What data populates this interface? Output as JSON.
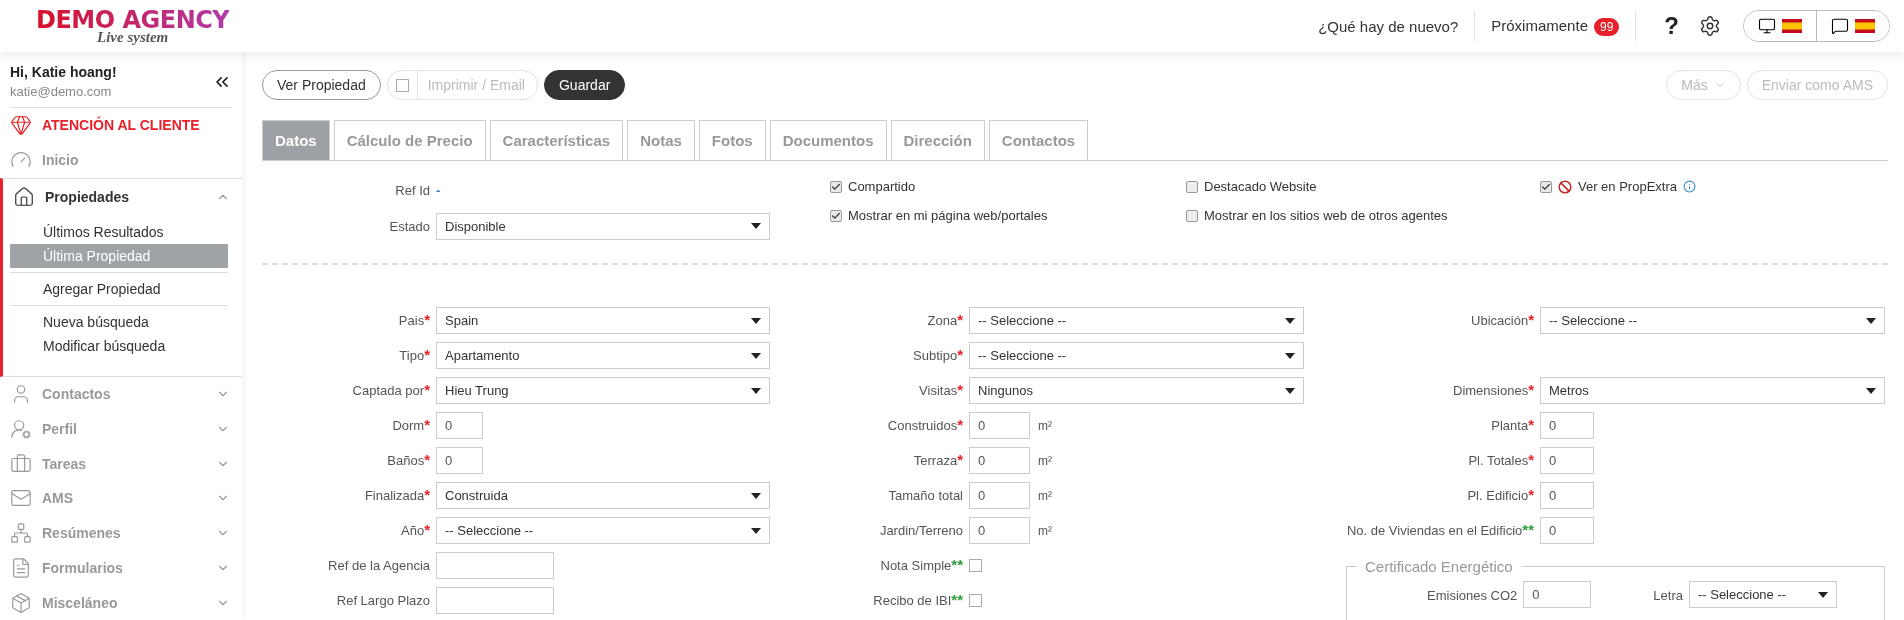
{
  "brand": {
    "name": "DEMO AGENCY",
    "tagline": "Live system"
  },
  "header": {
    "whats_new": "¿Qué hay de nuevo?",
    "upcoming": {
      "label": "Próximamente",
      "badge": "99"
    },
    "help": "?"
  },
  "user": {
    "greeting": "Hi, Katie hoang!",
    "email": "katie@demo.com"
  },
  "sidebar": {
    "items": [
      {
        "label": "ATENCIÓN AL CLIENTE",
        "kind": "highlight"
      },
      {
        "label": "Inicio",
        "kind": "link"
      },
      {
        "label": "Propiedades",
        "kind": "menu",
        "expanded": true,
        "child_groups": [
          {
            "items": [
              {
                "label": "Últimos Resultados",
                "selected": false
              },
              {
                "label": "Última Propiedad",
                "selected": true
              }
            ]
          },
          {
            "items": [
              {
                "label": "Agregar Propiedad",
                "selected": false
              }
            ]
          },
          {
            "items": [
              {
                "label": "Nueva búsqueda",
                "selected": false
              },
              {
                "label": "Modificar búsqueda",
                "selected": false
              }
            ]
          }
        ]
      },
      {
        "label": "Contactos",
        "kind": "menu",
        "expanded": false
      },
      {
        "label": "Perfil",
        "kind": "menu",
        "expanded": false
      },
      {
        "label": "Tareas",
        "kind": "menu",
        "expanded": false
      },
      {
        "label": "AMS",
        "kind": "menu",
        "expanded": false
      },
      {
        "label": "Resúmenes",
        "kind": "menu",
        "expanded": false
      },
      {
        "label": "Formularios",
        "kind": "menu",
        "expanded": false
      },
      {
        "label": "Misceláneo",
        "kind": "menu",
        "expanded": false
      }
    ]
  },
  "toolbar": {
    "buttons": [
      {
        "label": "Ver Propiedad",
        "kind": "outline",
        "disabled": false
      },
      {
        "label": "Imprimir / Email",
        "kind": "check",
        "disabled": true,
        "checked": false
      },
      {
        "label": "Guardar",
        "kind": "primary",
        "disabled": false
      }
    ],
    "right_buttons": [
      {
        "label": "Más",
        "kind": "dropdown",
        "disabled": true
      },
      {
        "label": "Enviar como AMS",
        "kind": "outline",
        "disabled": true
      }
    ]
  },
  "tabs": [
    {
      "label": "Datos",
      "selected": true
    },
    {
      "label": "Cálculo de Precio",
      "selected": false
    },
    {
      "label": "Características",
      "selected": false
    },
    {
      "label": "Notas",
      "selected": false
    },
    {
      "label": "Fotos",
      "selected": false
    },
    {
      "label": "Documentos",
      "selected": false
    },
    {
      "label": "Dirección",
      "selected": false
    },
    {
      "label": "Contactos",
      "selected": false
    }
  ],
  "summary": {
    "ref_id": {
      "label": "Ref Id",
      "value": "-"
    },
    "estado": {
      "label": "Estado",
      "value": "Disponible"
    },
    "options": [
      {
        "label": "Compartido",
        "checked": true
      },
      {
        "label": "Destacado Website",
        "checked": false
      },
      {
        "label": "Ver en PropExtra",
        "checked": true,
        "blocked": true,
        "info": true
      },
      {
        "label": "Mostrar en mi página web/portales",
        "checked": true
      },
      {
        "label": "Mostrar en los sitios web de otros agentes",
        "checked": false
      }
    ]
  },
  "form": {
    "columns": [
      {
        "fields": [
          {
            "kind": "select",
            "label": "Pais",
            "marker": {
              "text": "*",
              "color": "#e8202a"
            },
            "value": "Spain"
          },
          {
            "kind": "select",
            "label": "Tipo",
            "marker": {
              "text": "*",
              "color": "#e8202a"
            },
            "value": "Apartamento"
          },
          {
            "kind": "select",
            "label": "Captada por",
            "marker": {
              "text": "*",
              "color": "#e8202a"
            },
            "value": "Hieu Trung"
          },
          {
            "kind": "input",
            "label": "Dorm",
            "marker": {
              "text": "*",
              "color": "#e8202a"
            },
            "value": "0"
          },
          {
            "kind": "input",
            "label": "Baños",
            "marker": {
              "text": "*",
              "color": "#e8202a"
            },
            "value": "0"
          },
          {
            "kind": "select",
            "label": "Finalizada",
            "marker": {
              "text": "*",
              "color": "#e8202a"
            },
            "value": "Construida"
          },
          {
            "kind": "select",
            "label": "Año",
            "marker": {
              "text": "*",
              "color": "#e8202a"
            },
            "value": "-- Seleccione --"
          },
          {
            "kind": "text",
            "label": "Ref de la Agencia"
          },
          {
            "kind": "text",
            "label": "Ref Largo Plazo"
          }
        ]
      },
      {
        "fields": [
          {
            "kind": "select",
            "label": "Zona",
            "marker": {
              "text": "*",
              "color": "#e8202a"
            },
            "value": "-- Seleccione --"
          },
          {
            "kind": "select",
            "label": "Subtipo",
            "marker": {
              "text": "*",
              "color": "#e8202a"
            },
            "value": "-- Seleccione --"
          },
          {
            "kind": "select",
            "label": "Visitas",
            "marker": {
              "text": "*",
              "color": "#e8202a"
            },
            "value": "Ningunos"
          },
          {
            "kind": "area",
            "label": "Construidos",
            "marker": {
              "text": "*",
              "color": "#e8202a"
            },
            "value": "0",
            "unit": "m²"
          },
          {
            "kind": "area",
            "label": "Terraza",
            "marker": {
              "text": "*",
              "color": "#e8202a"
            },
            "value": "0",
            "unit": "m²"
          },
          {
            "kind": "area",
            "label": "Tamaño total",
            "value": "0",
            "unit": "m²"
          },
          {
            "kind": "area",
            "label": "Jardin/Terreno",
            "value": "0",
            "unit": "m²"
          },
          {
            "kind": "checkbox",
            "label": "Nota Simple",
            "marker": {
              "text": "**",
              "color": "#2e9e3a"
            },
            "checked": false
          },
          {
            "kind": "checkbox",
            "label": "Recibo de IBI",
            "marker": {
              "text": "**",
              "color": "#2e9e3a"
            },
            "checked": false
          }
        ]
      },
      {
        "fields": [
          {
            "kind": "select",
            "label": "Ubicación",
            "marker": {
              "text": "*",
              "color": "#e8202a"
            },
            "value": "-- Seleccione --"
          },
          {
            "kind": "blank"
          },
          {
            "kind": "select",
            "label": "Dimensiones",
            "marker": {
              "text": "*",
              "color": "#e8202a"
            },
            "value": "Metros"
          },
          {
            "kind": "input",
            "label": "Planta",
            "marker": {
              "text": "*",
              "color": "#e8202a"
            },
            "value": "0"
          },
          {
            "kind": "input",
            "label": "Pl. Totales",
            "marker": {
              "text": "*",
              "color": "#e8202a"
            },
            "value": "0"
          },
          {
            "kind": "input",
            "label": "Pl. Edificio",
            "marker": {
              "text": "*",
              "color": "#e8202a"
            },
            "value": "0"
          },
          {
            "kind": "input",
            "label": "No. de Viviendas en el Edificio",
            "marker": {
              "text": "**",
              "color": "#2e9e3a"
            },
            "value": "0"
          },
          {
            "kind": "group",
            "legend": "Certificado Energético",
            "fields": [
              {
                "kind": "input",
                "label": "Emisiones CO2",
                "value": "0"
              },
              {
                "kind": "select",
                "label": "Letra",
                "value": "-- Seleccione --"
              }
            ]
          }
        ]
      }
    ]
  }
}
